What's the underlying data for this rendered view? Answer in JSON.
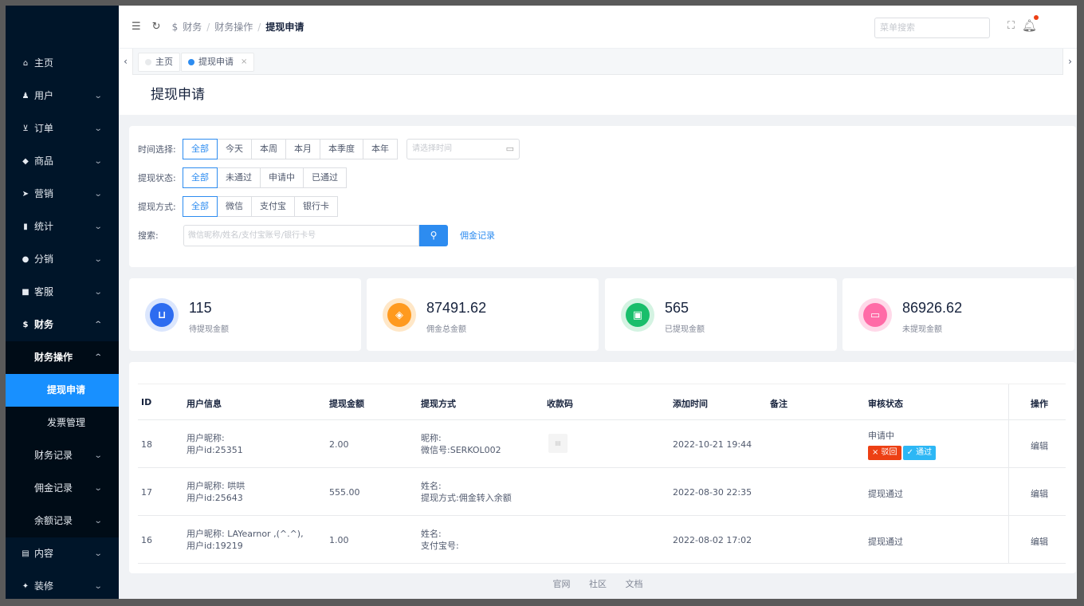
{
  "sidebar": {
    "items": [
      {
        "icon": "home-icon",
        "glyph": "⌂",
        "label": "主页"
      },
      {
        "icon": "user-icon",
        "glyph": "♟",
        "label": "用户"
      },
      {
        "icon": "cart-icon",
        "glyph": "⊻",
        "label": "订单"
      },
      {
        "icon": "goods-icon",
        "glyph": "◆",
        "label": "商品"
      },
      {
        "icon": "marketing-icon",
        "glyph": "➤",
        "label": "营销"
      },
      {
        "icon": "chart-icon",
        "glyph": "▮",
        "label": "统计"
      },
      {
        "icon": "distribution-icon",
        "glyph": "●",
        "label": "分销"
      },
      {
        "icon": "service-icon",
        "glyph": "■",
        "label": "客服"
      },
      {
        "icon": "dollar-icon",
        "glyph": "$",
        "label": "财务"
      }
    ],
    "finance_sub": {
      "label": "财务操作"
    },
    "finance_children": [
      "提现申请",
      "发票管理"
    ],
    "finance_more": [
      "财务记录",
      "佣金记录",
      "余额记录"
    ],
    "bottom": [
      {
        "icon": "content-icon",
        "glyph": "▤",
        "label": "内容"
      },
      {
        "icon": "decoration-icon",
        "glyph": "✦",
        "label": "装修"
      }
    ]
  },
  "header": {
    "breadcrumb": [
      "财务",
      "财务操作",
      "提现申请"
    ],
    "search_placeholder": "菜单搜索"
  },
  "tabs": [
    {
      "label": "主页"
    },
    {
      "label": "提现申请"
    }
  ],
  "page_title": "提现申请",
  "filters": {
    "time_label": "时间选择:",
    "time_options": [
      "全部",
      "今天",
      "本周",
      "本月",
      "本季度",
      "本年"
    ],
    "date_placeholder": "请选择时间",
    "status_label": "提现状态:",
    "status_options": [
      "全部",
      "未通过",
      "申请中",
      "已通过"
    ],
    "method_label": "提现方式:",
    "method_options": [
      "全部",
      "微信",
      "支付宝",
      "银行卡"
    ],
    "search_label": "搜索:",
    "search_placeholder": "微信昵称/姓名/支付宝账号/银行卡号",
    "commission_link": "佣金记录"
  },
  "stats": [
    {
      "value": "115",
      "label": "待提现金额",
      "color": "#2d6cf0",
      "icon": "basket-icon"
    },
    {
      "value": "87491.62",
      "label": "佣金总金额",
      "color": "#ff9a1f",
      "icon": "tag-icon"
    },
    {
      "value": "565",
      "label": "已提现金额",
      "color": "#19be6b",
      "icon": "cash-icon"
    },
    {
      "value": "86926.62",
      "label": "未提现金额",
      "color": "#ff6ba7",
      "icon": "card-icon"
    }
  ],
  "table": {
    "columns": [
      "ID",
      "用户信息",
      "提现金额",
      "提现方式",
      "收款码",
      "添加时间",
      "备注",
      "审核状态",
      "操作"
    ],
    "rows": [
      {
        "id": "18",
        "user1": "用户昵称:",
        "user2": "用户id:25351",
        "amount": "2.00",
        "method1": "昵称:",
        "method2": "微信号:SERKOL002",
        "time": "2022-10-21 19:44",
        "status": "申请中",
        "reject": "× 驳回",
        "pass": "✓ 通过",
        "op": "编辑"
      },
      {
        "id": "17",
        "user1": "用户昵称: 哄哄",
        "user2": "用户id:25643",
        "amount": "555.00",
        "method1": "姓名:",
        "method2": "提现方式:佣金转入余额",
        "time": "2022-08-30 22:35",
        "status": "提现通过",
        "op": "编辑"
      },
      {
        "id": "16",
        "user1": "用户昵称: LAYearnor ,(^.^),",
        "user2": "用户id:19219",
        "amount": "1.00",
        "method1": "姓名:",
        "method2": "支付宝号:",
        "time": "2022-08-02 17:02",
        "status": "提现通过",
        "op": "编辑"
      }
    ]
  },
  "footer": {
    "links": [
      "官网",
      "社区",
      "文档"
    ]
  }
}
